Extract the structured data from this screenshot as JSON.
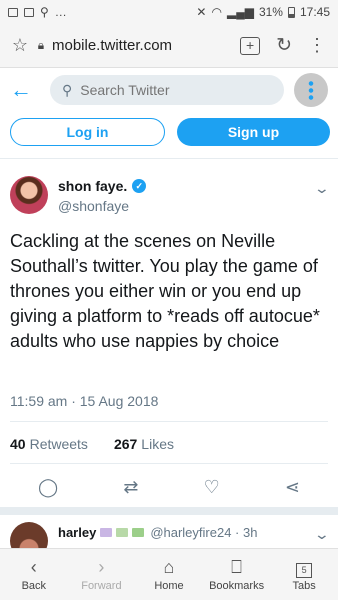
{
  "status_bar": {
    "battery": "31%",
    "time": "17:45"
  },
  "browser": {
    "url": "mobile.twitter.com"
  },
  "search": {
    "placeholder": "Search Twitter"
  },
  "auth": {
    "login": "Log in",
    "signup": "Sign up"
  },
  "tweet": {
    "name": "shon faye.",
    "handle": "@shonfaye",
    "text": "Cackling at the scenes on Neville Southall’s twitter. You play the game of thrones you either win or you end up giving a platform to *reads off autocue* adults who use nappies by choice",
    "timestamp": "11:59 am · 15 Aug 2018",
    "retweets_count": "40",
    "retweets_label": "Retweets",
    "likes_count": "267",
    "likes_label": "Likes"
  },
  "next_tweet": {
    "name": "harley",
    "handle": "@harleyfire24 · 3h"
  },
  "bottom_nav": {
    "back": "Back",
    "forward": "Forward",
    "home": "Home",
    "bookmarks": "Bookmarks",
    "tabs": "Tabs",
    "tabs_count": "5"
  },
  "colors": {
    "accent": "#1da1f2",
    "muted": "#657786"
  }
}
